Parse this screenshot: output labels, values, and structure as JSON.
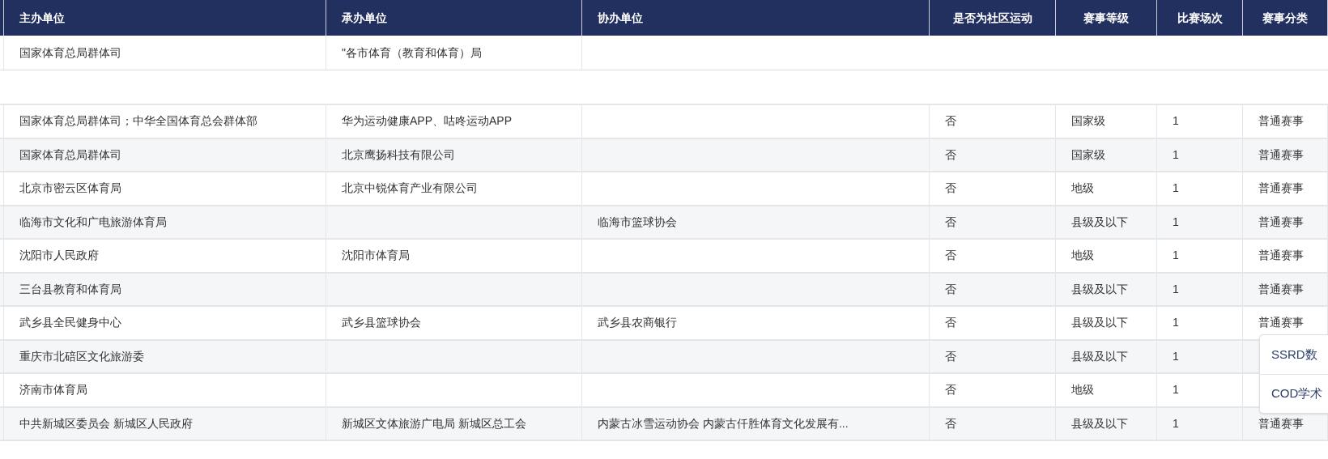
{
  "table": {
    "columns": [
      "主办单位",
      "承办单位",
      "协办单位",
      "是否为社区运动",
      "赛事等级",
      "比赛场次",
      "赛事分类"
    ],
    "top_row": {
      "host": "国家体育总局群体司",
      "organizer": "\"各市体育（教育和体育）局"
    },
    "rows": [
      {
        "host": "国家体育总局群体司；中华全国体育总会群体部",
        "organizer": "华为运动健康APP、咕咚运动APP",
        "community": "否",
        "level": "国家级",
        "matches": "1",
        "category": "普通赛事"
      },
      {
        "host": "国家体育总局群体司",
        "organizer": "北京鹰扬科技有限公司",
        "community": "否",
        "level": "国家级",
        "matches": "1",
        "category": "普通赛事"
      },
      {
        "host": "北京市密云区体育局",
        "organizer": "北京中锐体育产业有限公司",
        "community": "否",
        "level": "地级",
        "matches": "1",
        "category": "普通赛事"
      },
      {
        "host": "临海市文化和广电旅游体育局",
        "co_organizer": "临海市篮球协会",
        "community": "否",
        "level": "县级及以下",
        "matches": "1",
        "category": "普通赛事"
      },
      {
        "host": "沈阳市人民政府",
        "organizer": "沈阳市体育局",
        "community": "否",
        "level": "地级",
        "matches": "1",
        "category": "普通赛事"
      },
      {
        "host": "三台县教育和体育局",
        "community": "否",
        "level": "县级及以下",
        "matches": "1",
        "category": "普通赛事"
      },
      {
        "host": "武乡县全民健身中心",
        "organizer": "武乡县篮球协会",
        "co_organizer": "武乡县农商银行",
        "community": "否",
        "level": "县级及以下",
        "matches": "1",
        "category": "普通赛事"
      },
      {
        "host": "重庆市北碚区文化旅游委",
        "community": "否",
        "level": "县级及以下",
        "matches": "1"
      },
      {
        "host": "济南市体育局",
        "community": "否",
        "level": "地级",
        "matches": "1"
      },
      {
        "host": "中共新城区委员会 新城区人民政府",
        "organizer": "新城区文体旅游广电局 新城区总工会",
        "co_organizer": "内蒙古冰雪运动协会 内蒙古仟胜体育文化发展有...",
        "community": "否",
        "level": "县级及以下",
        "matches": "1",
        "category": "普通赛事"
      }
    ]
  },
  "popup_menu": {
    "items": [
      "SSRD数",
      "COD学术"
    ]
  }
}
